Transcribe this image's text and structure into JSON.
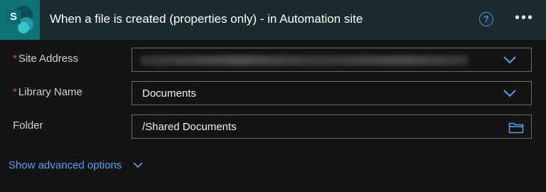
{
  "header": {
    "logo_letter": "S",
    "title": "When a file is created (properties only) - in Automation site",
    "help_glyph": "?",
    "more_glyph": "•••"
  },
  "fields": {
    "site_address": {
      "label": "Site Address",
      "required_mark": "*",
      "value": ""
    },
    "library_name": {
      "label": "Library Name",
      "required_mark": "*",
      "value": "Documents"
    },
    "folder": {
      "label": "Folder",
      "value": "/Shared Documents"
    }
  },
  "advanced": {
    "label": "Show advanced options"
  },
  "colors": {
    "accent": "#5b9ef0",
    "header_bg": "#1b2b2e",
    "logo_bg": "#0f7378",
    "required": "#e24a4a"
  },
  "icons": [
    "sharepoint-logo-icon",
    "help-icon",
    "more-options-icon",
    "chevron-down-icon",
    "folder-icon"
  ]
}
